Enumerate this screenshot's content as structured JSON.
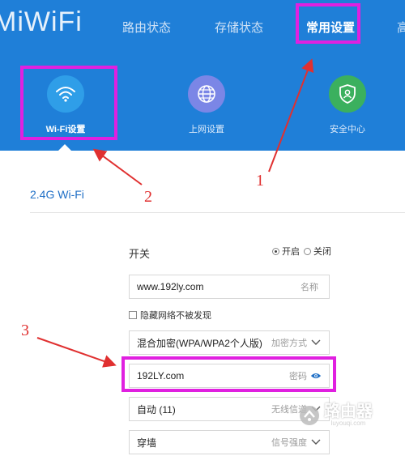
{
  "header": {
    "logo": "MiWiFi",
    "nav": [
      "路由状态",
      "存储状态",
      "常用设置",
      "高"
    ],
    "active_nav": "常用设置",
    "tiles": [
      {
        "label": "Wi-Fi设置",
        "icon": "wifi-icon",
        "color": "#2f9ee8"
      },
      {
        "label": "上网设置",
        "icon": "globe-icon",
        "color": "#7b86e6"
      },
      {
        "label": "安全中心",
        "icon": "shield-icon",
        "color": "#3bb05e"
      }
    ]
  },
  "section": {
    "title": "2.4G Wi-Fi"
  },
  "form": {
    "switch_label": "开关",
    "radio_on": "开启",
    "radio_off": "关闭",
    "ssid": {
      "value": "www.192ly.com",
      "hint": "名称"
    },
    "hide_network": "隐藏网络不被发现",
    "encryption": {
      "value": "混合加密(WPA/WPA2个人版)",
      "hint": "加密方式"
    },
    "password": {
      "value": "192LY.com",
      "hint": "密码"
    },
    "channel": {
      "value": "自动 (11)",
      "hint": "无线信道"
    },
    "signal": {
      "value": "穿墙",
      "hint": "信号强度"
    }
  },
  "annotations": [
    "1",
    "2",
    "3"
  ],
  "watermark": {
    "text": "路由器",
    "sub": "luyouqi.com"
  },
  "colors": {
    "header": "#1f7fd8",
    "highlight": "#e020e0",
    "arrow": "#e03030",
    "link": "#1f6fc6"
  }
}
